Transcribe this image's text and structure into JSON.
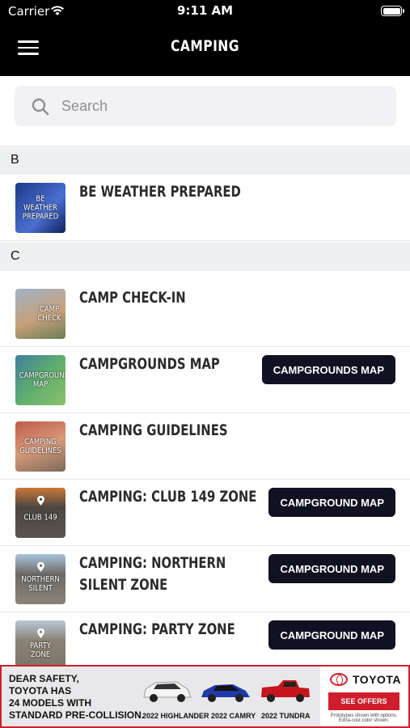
{
  "status_bar": {
    "carrier": "Carrier",
    "time": "9:11 AM"
  },
  "header": {
    "title": "CAMPING",
    "menu_icon": "hamburger-menu-icon"
  },
  "search": {
    "placeholder": "Search",
    "value": ""
  },
  "sections": [
    {
      "letter": "B"
    },
    {
      "letter": "C"
    }
  ],
  "items": [
    {
      "title": "BE WEATHER PREPARED",
      "thumb_text": "BE\nWEATHER\nPREPARED",
      "thumb_color": "#1d3a8a"
    },
    {
      "title": "CAMP CHECK-IN",
      "thumb_text": "CAMP\nCHECK",
      "thumb_color": "#7a8fa6"
    },
    {
      "title": "CAMPGROUNDS MAP",
      "thumb_text": "CAMPGROUNDS\nMAP",
      "thumb_color": "#4e8a72",
      "button": "CAMPGROUNDS MAP"
    },
    {
      "title": "CAMPING GUIDELINES",
      "thumb_text": "CAMPING\nGUIDELINES",
      "thumb_color": "#a06a55"
    },
    {
      "title": "CAMPING: CLUB 149 ZONE",
      "thumb_text": "CLUB 149",
      "thumb_color": "#4a4540",
      "button": "CAMPGROUND MAP"
    },
    {
      "title": "CAMPING: NORTHERN SILENT ZONE",
      "thumb_text": "NORTHERN\nSILENT",
      "thumb_color": "#6d6a66",
      "button": "CAMPGROUND MAP"
    },
    {
      "title": "CAMPING: PARTY ZONE",
      "thumb_text": "PARTY\nZONE",
      "thumb_color": "#8a8275",
      "button": "CAMPGROUND MAP"
    }
  ],
  "ad": {
    "headline_lines": [
      "DEAR SAFETY,",
      "TOYOTA HAS",
      "24 MODELS WITH",
      "STANDARD PRE-COLLISION."
    ],
    "cars": [
      {
        "label": "2022 HIGHLANDER",
        "color": "#f4f4f4"
      },
      {
        "label": "2022 CAMRY",
        "color": "#1f3aa8"
      },
      {
        "label": "2022 TUNDRA",
        "color": "#c4161c"
      }
    ],
    "brand": "TOYOTA",
    "cta": "SEE OFFERS",
    "disclaimer": "Prototypes shown with options. Extra-cost color shown."
  },
  "colors": {
    "accent": "#d01e2e",
    "button_bg": "#111122",
    "section_bg": "#eff0f2"
  }
}
